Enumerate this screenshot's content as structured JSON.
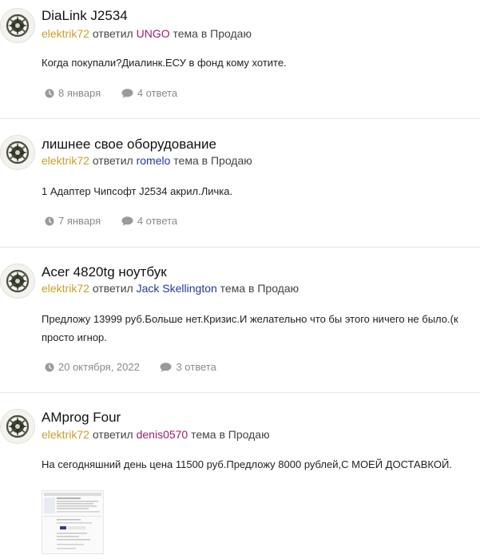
{
  "posts": [
    {
      "title": "DiaLink J2534",
      "author": "elektrik72",
      "replied_label": "ответил",
      "op": "UNGO",
      "forum_prefix": "тема в",
      "forum": "Продаю",
      "snippet": "Когда покупали?Диалинк.ЕСУ в фонд кому хотите.",
      "date": "8 января",
      "replies": "4 ответа"
    },
    {
      "title": "лишнее свое оборудование",
      "author": "elektrik72",
      "replied_label": "ответил",
      "op": "romelo",
      "forum_prefix": "тема в",
      "forum": "Продаю",
      "snippet": "1 Адаптер Чипсофт J2534 акрил.Личка.",
      "date": "7 января",
      "replies": "4 ответа"
    },
    {
      "title": "Acer 4820tg ноутбук",
      "author": "elektrik72",
      "replied_label": "ответил",
      "op": "Jack Skellington",
      "forum_prefix": "тема в",
      "forum": "Продаю",
      "snippet_line1": "Предложу 13999 руб.Больше нет.Кризис.И желательно что бы этого ничего не было.(к",
      "snippet_line2": "просто игнор.",
      "date": "20 октября, 2022",
      "replies": "3 ответа"
    },
    {
      "title": "AMprog Four",
      "author": "elektrik72",
      "replied_label": "ответил",
      "op": "denis0570",
      "forum_prefix": "тема в",
      "forum": "Продаю",
      "snippet": "На сегодняшний день цена 11500 руб.Предложу 8000 рублей,С МОЕЙ ДОСТАВКОЙ."
    }
  ],
  "icons": {
    "clock": "clock-icon",
    "comment": "comment-icon",
    "avatar": "avatar-emblem"
  },
  "colors": {
    "author": "#c8a02a",
    "op_pink": "#9b1e6e",
    "op_blue": "#223a9b",
    "meta": "#8a8a8a"
  }
}
